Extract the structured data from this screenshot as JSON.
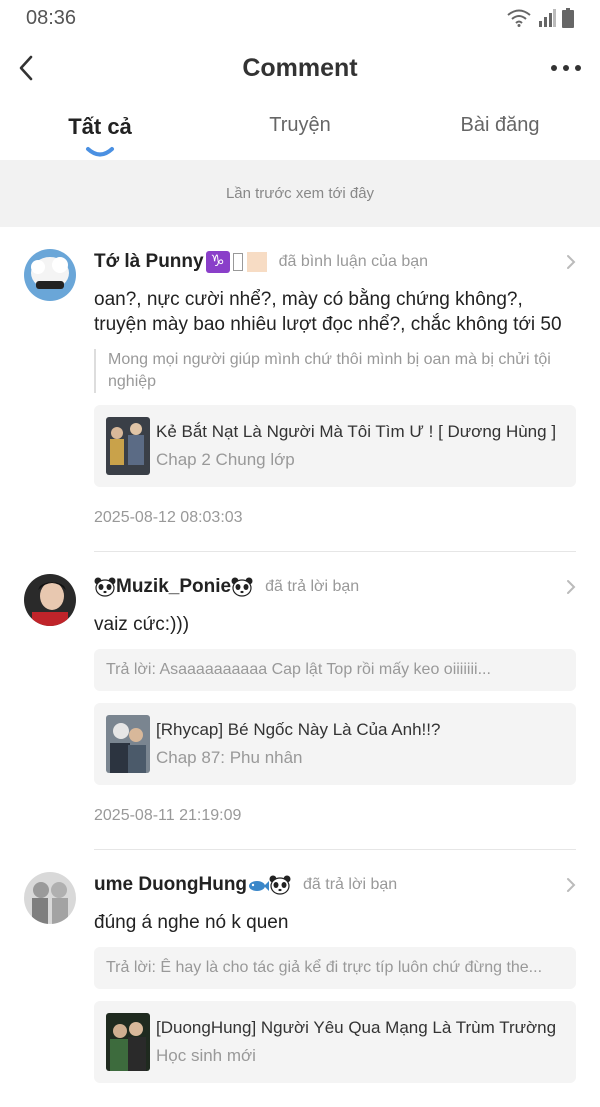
{
  "status_bar": {
    "time": "08:36"
  },
  "header": {
    "title": "Comment"
  },
  "tabs": [
    {
      "label": "Tất cả",
      "active": true
    },
    {
      "label": "Truyện",
      "active": false
    },
    {
      "label": "Bài đăng",
      "active": false
    }
  ],
  "banner": {
    "text": "Lần trước xem tới đây"
  },
  "items": [
    {
      "username": "Tớ là Punny",
      "action": "đã bình luận của bạn",
      "comment": "oan?, nực cười nhể?, mày có bằng chứng không?, truyện mày bao nhiêu lượt đọc nhể?, chắc không tới 50",
      "quote": "Mong mọi người giúp mình chứ thôi mình bị oan mà bị chửi tội nghiệp",
      "story_title": "Kẻ Bắt Nạt Là Người Mà Tôi Tìm Ư ! [ Dương Hùng ]",
      "story_chapter": "Chap 2 Chung lớp",
      "timestamp": "2025-08-12 08:03:03"
    },
    {
      "username": "Muzik_Ponie",
      "action": "đã trả lời bạn",
      "comment": "vaiz cức:)))",
      "reply": "Trả lời: Asaaaaaaaaaa Cap lật Top rồi mấy keo oiiiiiii...",
      "story_title": "[Rhycap] Bé Ngốc Này Là Của Anh!!?",
      "story_chapter": "Chap 87: Phu nhân",
      "timestamp": "2025-08-11 21:19:09"
    },
    {
      "username": "ume DuongHung",
      "action": "đã trả lời bạn",
      "comment": "đúng á nghe nó k quen",
      "reply": "Trả lời: Ê hay là cho tác giả kể đi trực típ luôn chứ đừng the...",
      "story_title": "[DuongHung] Người Yêu Qua Mạng Là Trùm Trường",
      "story_chapter": "Học sinh mới"
    }
  ],
  "icons": {
    "back": "chevron-left-icon",
    "more": "more-horizontal-icon",
    "wifi": "wifi-icon",
    "signal": "signal-icon",
    "battery": "battery-icon",
    "chevron": "chevron-right-icon"
  },
  "colors": {
    "accent": "#4a90e2",
    "background": "#ffffff",
    "banner": "#f2f2f2",
    "card": "#f4f4f4"
  }
}
